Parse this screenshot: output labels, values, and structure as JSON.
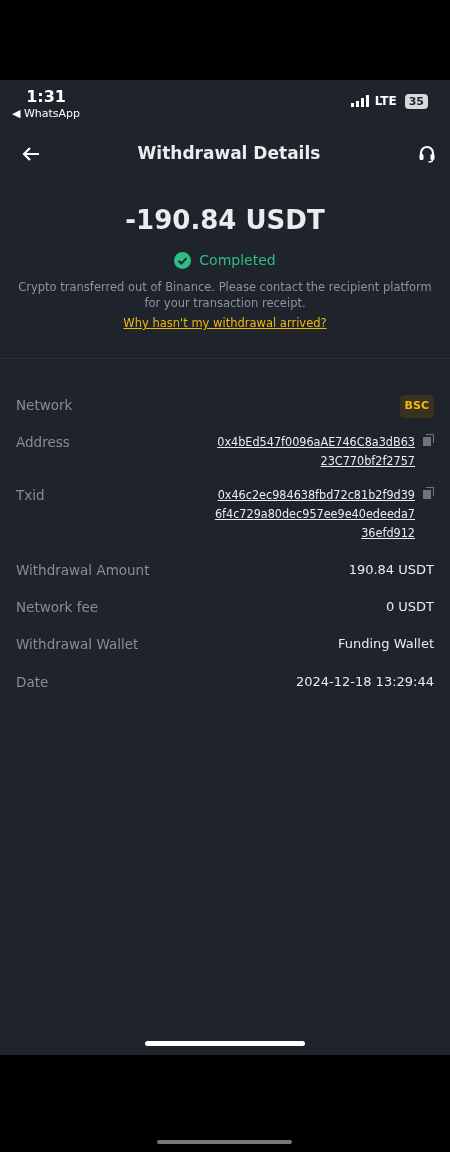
{
  "status_bar": {
    "time": "1:31",
    "back_app": "◀ WhatsApp",
    "network": "LTE",
    "battery": "35"
  },
  "header": {
    "title": "Withdrawal Details"
  },
  "summary": {
    "amount": "-190.84 USDT",
    "status": "Completed",
    "note": "Crypto transferred out of Binance. Please contact the recipient platform for your transaction receipt.",
    "help_link": "Why hasn't my withdrawal arrived?"
  },
  "details": [
    {
      "label": "Network",
      "kind": "badge",
      "value_lines": [
        "BSC"
      ]
    },
    {
      "label": "Address",
      "kind": "copy",
      "value_lines": [
        "0x4bEd547f0096aAE746C8a3dB63",
        "23C770bf2f2757"
      ]
    },
    {
      "label": "Txid",
      "kind": "copy",
      "value_lines": [
        "0x46c2ec984638fbd72c81b2f9d39",
        "6f4c729a80dec957ee9e40edeeda7",
        "36efd912"
      ]
    },
    {
      "label": "Withdrawal Amount",
      "kind": "text",
      "value_lines": [
        "190.84 USDT"
      ]
    },
    {
      "label": "Network fee",
      "kind": "text",
      "value_lines": [
        "0 USDT"
      ]
    },
    {
      "label": "Withdrawal Wallet",
      "kind": "text",
      "value_lines": [
        "Funding Wallet"
      ]
    },
    {
      "label": "Date",
      "kind": "text",
      "value_lines": [
        "2024-12-18 13:29:44"
      ]
    }
  ]
}
